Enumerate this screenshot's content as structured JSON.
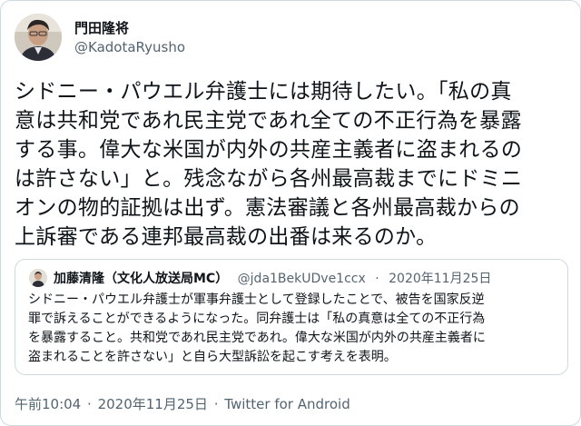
{
  "author": {
    "name": "門田隆将",
    "handle": "@KadotaRyusho"
  },
  "tweet": {
    "lines": [
      "シドニー・パウエル弁護士には期待したい。「私の真",
      "意は共和党であれ民主党であれ全ての不正行為を暴露",
      "する事。偉大な米国が内外の共産主義者に盗まれるの",
      "は許さない」と。残念ながら各州最高裁までにドミニ",
      "オンの物的証拠は出ず。憲法審議と各州最高裁からの",
      "上訴審である連邦最高裁の出番は来るのか。"
    ]
  },
  "quote": {
    "name": "加藤清隆（文化人放送局MC）",
    "handle": "@jda1BekUDve1ccx",
    "separator": "·",
    "date": "2020年11月25日",
    "lines": [
      "シドニー・パウエル弁護士が軍事弁護士として登録したことで、被告を国家反逆",
      "罪で訴えることができるようになった。同弁護士は「私の真意は全ての不正行為",
      "を暴露すること。共和党であれ民主党であれ。偉大な米国が内外の共産主義者に",
      "盗まれることを許さない」と自ら大型訴訟を起こす考えを表明。"
    ]
  },
  "footer": {
    "time": "午前10:04",
    "separator": "·",
    "date": "2020年11月25日",
    "separator2": "·",
    "client": "Twitter for Android"
  }
}
